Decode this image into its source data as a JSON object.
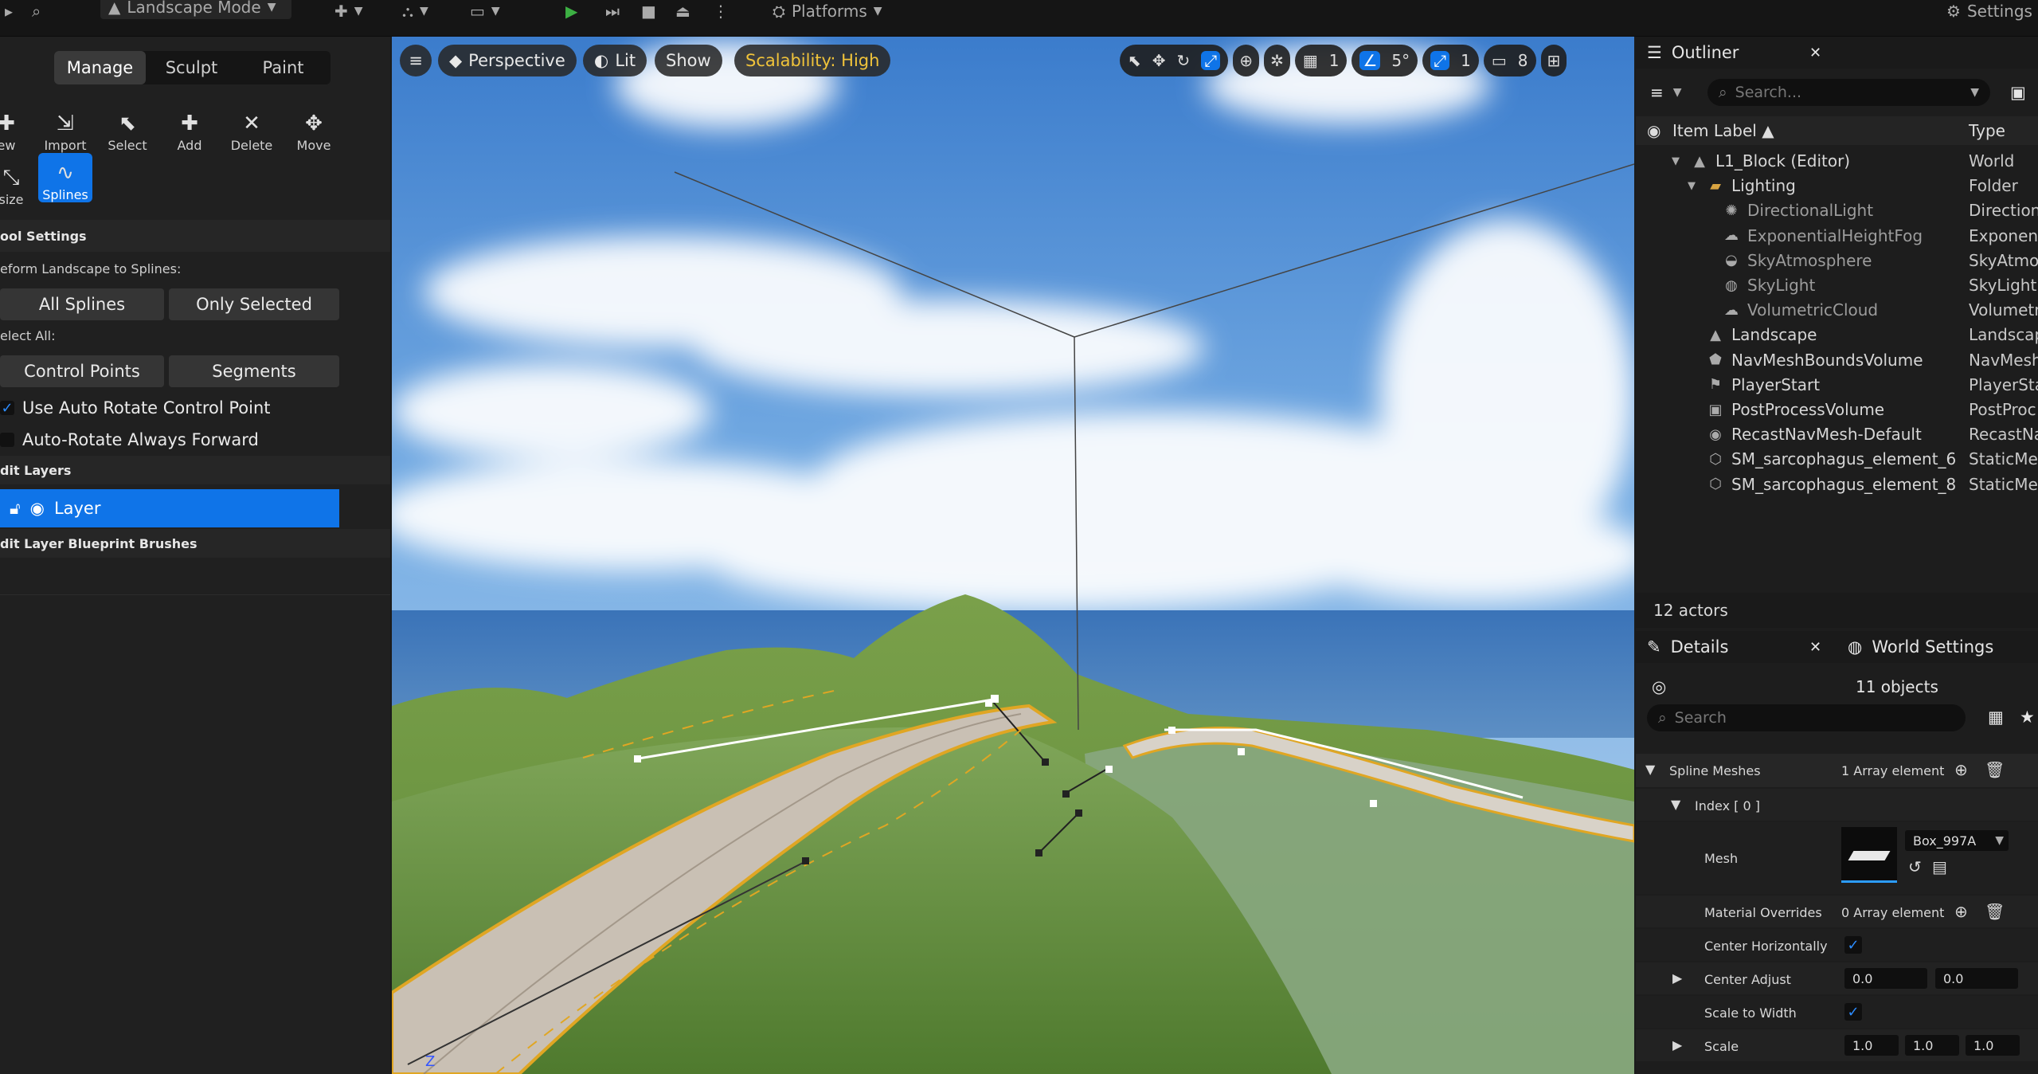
{
  "toolbar": {
    "mode_label": "Landscape Mode",
    "platforms_label": "Platforms",
    "settings_label": "Settings"
  },
  "left_panel": {
    "mode_tabs": [
      "Manage",
      "Sculpt",
      "Paint"
    ],
    "tools_row1": [
      {
        "label": "New",
        "display": "ew",
        "icon": "new-icon"
      },
      {
        "label": "Import",
        "icon": "import-icon"
      },
      {
        "label": "Select",
        "icon": "select-icon"
      },
      {
        "label": "Add",
        "icon": "add-icon"
      },
      {
        "label": "Delete",
        "icon": "delete-icon"
      },
      {
        "label": "Move",
        "icon": "move-icon"
      }
    ],
    "tools_row2": [
      {
        "label": "Resize",
        "display": "size",
        "icon": "resize-icon"
      },
      {
        "label": "Splines",
        "icon": "splines-icon"
      }
    ],
    "tool_settings_header": "Tool Settings",
    "tool_settings_display": "ool Settings",
    "deform_label": "eform Landscape to Splines:",
    "all_splines": "All Splines",
    "only_selected": "Only Selected",
    "select_all_label": "elect All:",
    "control_points": "Control Points",
    "segments": "Segments",
    "use_auto_rotate": "Use Auto Rotate Control Point",
    "auto_rotate_forward": "Auto-Rotate Always Forward",
    "edit_layers_header": "dit Layers",
    "layer_name": "Layer",
    "edit_layer_bp_header": "dit Layer Blueprint Brushes"
  },
  "viewport": {
    "perspective": "Perspective",
    "lit": "Lit",
    "show": "Show",
    "scalability": "Scalability: High",
    "grid_value": "1",
    "angle_value": "5°",
    "scale_value": "1",
    "camera_speed": "8",
    "axis_label": "Z"
  },
  "outliner": {
    "title": "Outliner",
    "search_placeholder": "Search...",
    "col_label": "Item Label",
    "col_type": "Type",
    "items": [
      {
        "label": "L1_Block (Editor)",
        "type": "World",
        "indent": 0,
        "icon": "world-icon"
      },
      {
        "label": "Lighting",
        "type": "Folder",
        "indent": 1,
        "icon": "folder-icon"
      },
      {
        "label": "DirectionalLight",
        "type": "Direction",
        "indent": 2,
        "icon": "directional-light-icon"
      },
      {
        "label": "ExponentialHeightFog",
        "type": "Exponent",
        "indent": 2,
        "icon": "fog-icon"
      },
      {
        "label": "SkyAtmosphere",
        "type": "SkyAtmo",
        "indent": 2,
        "icon": "sky-atmosphere-icon"
      },
      {
        "label": "SkyLight",
        "type": "SkyLight",
        "indent": 2,
        "icon": "skylight-icon"
      },
      {
        "label": "VolumetricCloud",
        "type": "Volumetr",
        "indent": 2,
        "icon": "cloud-icon"
      },
      {
        "label": "Landscape",
        "type": "Landscap",
        "indent": 1,
        "icon": "landscape-icon"
      },
      {
        "label": "NavMeshBoundsVolume",
        "type": "NavMesh",
        "indent": 1,
        "icon": "navmesh-icon"
      },
      {
        "label": "PlayerStart",
        "type": "PlayerSta",
        "indent": 1,
        "icon": "player-start-icon"
      },
      {
        "label": "PostProcessVolume",
        "type": "PostProc",
        "indent": 1,
        "icon": "postprocess-icon"
      },
      {
        "label": "RecastNavMesh-Default",
        "type": "RecastNa",
        "indent": 1,
        "icon": "recast-icon"
      },
      {
        "label": "SM_sarcophagus_element_6",
        "type": "StaticMe",
        "indent": 1,
        "icon": "static-mesh-icon"
      },
      {
        "label": "SM_sarcophagus_element_8",
        "type": "StaticMe",
        "indent": 1,
        "icon": "static-mesh-icon"
      }
    ],
    "actor_count": "12 actors"
  },
  "details": {
    "title": "Details",
    "world_settings": "World Settings",
    "object_count": "11 objects",
    "search_placeholder": "Search",
    "spline_meshes": "Spline Meshes",
    "spline_meshes_value": "1 Array element",
    "index_label": "Index [ 0 ]",
    "mesh_label": "Mesh",
    "mesh_value": "Box_997A",
    "material_overrides": "Material Overrides",
    "material_overrides_value": "0 Array element",
    "center_horizontally": "Center Horizontally",
    "center_adjust": "Center Adjust",
    "center_adjust_x": "0.0",
    "center_adjust_y": "0.0",
    "scale_to_width": "Scale to Width",
    "scale": "Scale",
    "scale_x": "1.0",
    "scale_y": "1.0",
    "scale_z": "1.0"
  }
}
